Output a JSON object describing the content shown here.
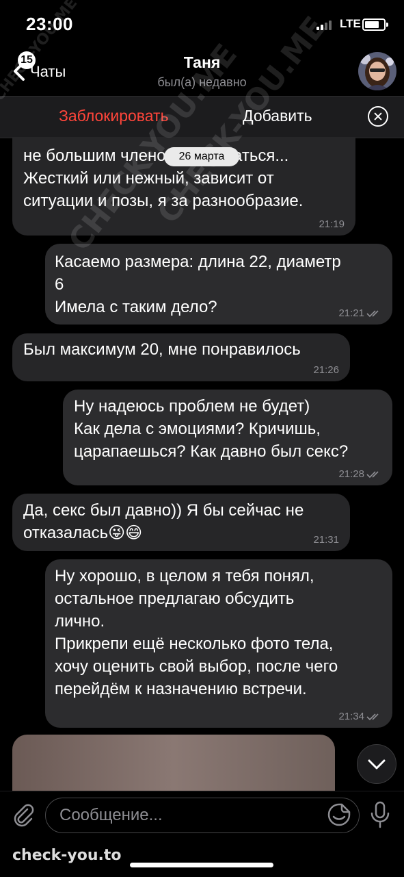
{
  "status_bar": {
    "time": "23:00",
    "network": "LTE"
  },
  "header": {
    "back_badge": "15",
    "back_label": "Чаты",
    "title": "Таня",
    "subtitle": "был(а) недавно"
  },
  "action_bar": {
    "block_label": "Заблокировать",
    "add_label": "Добавить"
  },
  "chat": {
    "date_pill": "26 марта",
    "messages": [
      {
        "direction": "in",
        "text": "не большим членом потрахаться...\nЖесткий или нежный, зависит от\nситуации и позы, я за разнообразие.",
        "time": "21:19"
      },
      {
        "direction": "out",
        "text": "Касаемо размера: длина 22, диаметр\n6\nИмела с таким дело?",
        "time": "21:21"
      },
      {
        "direction": "in",
        "text": "Был максимум 20, мне понравилось",
        "time": "21:26"
      },
      {
        "direction": "out",
        "text": "Ну надеюсь проблем не будет)\nКак дела с эмоциями? Кричишь,\nцарапаешься? Как давно был секс?",
        "time": "21:28"
      },
      {
        "direction": "in",
        "text": "Да, секс был давно)) Я бы сейчас не\nотказалась😜😄",
        "time": "21:31"
      },
      {
        "direction": "out",
        "text": "Ну хорошо, в целом я тебя понял,\nостальное предлагаю обсудить\nлично.\nПрикрепи ещё несколько фото тела,\nхочу оценить свой выбор, после чего\nперейдём к назначению встречи.",
        "time": "21:34"
      }
    ]
  },
  "input": {
    "placeholder": "Сообщение..."
  },
  "watermarks": {
    "bottom": "check-you.to",
    "diagonal": "CHECK-YOU.ME"
  },
  "colors": {
    "block": "#ff453a",
    "bubble": "#262628",
    "background": "#000000"
  }
}
